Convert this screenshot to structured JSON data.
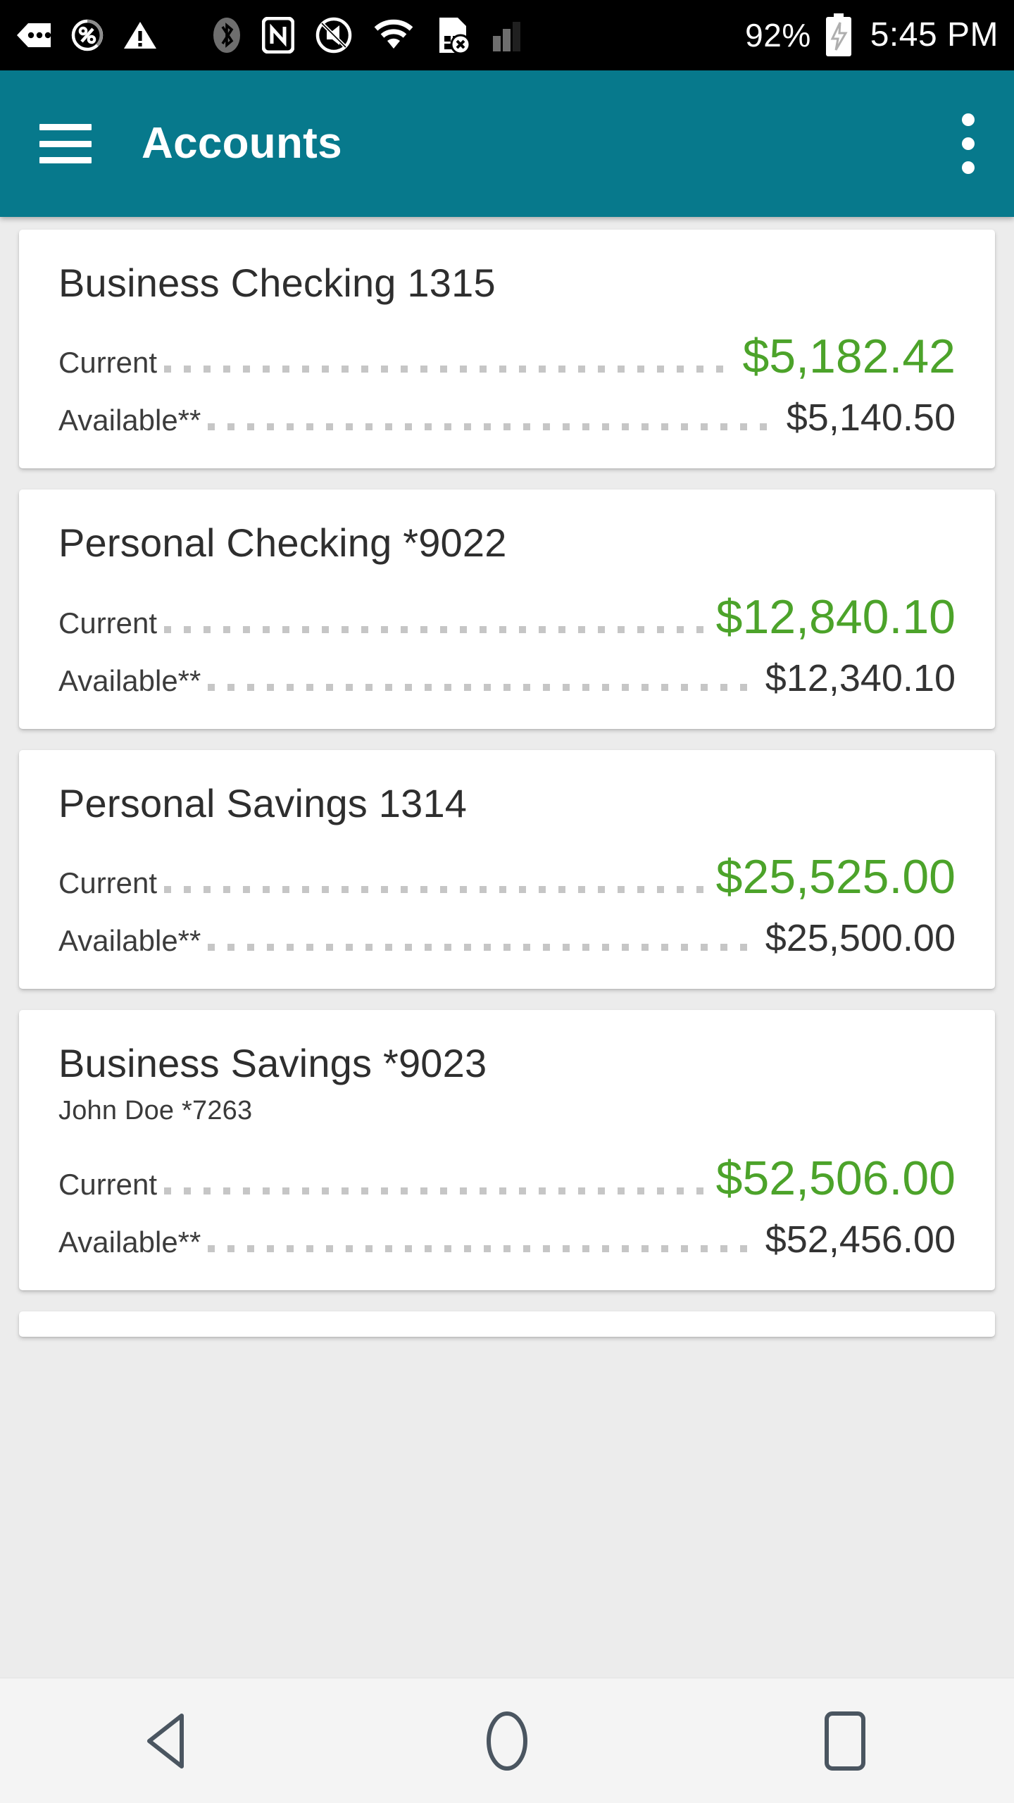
{
  "status_bar": {
    "battery_percent": "92%",
    "clock": "5:45 PM",
    "icons_left": [
      "more-notifications-icon",
      "data-saver-percent-icon",
      "warning-triangle-icon"
    ],
    "icons_mid": [
      "bluetooth-icon",
      "nfc-icon",
      "mute-vibrate-off-icon",
      "wifi-icon",
      "sim-card-error-icon",
      "signal-bars-icon"
    ],
    "icons_right": [
      "battery-charging-icon"
    ],
    "background_color": "#000000",
    "foreground_color": "#FFFFFF"
  },
  "app_bar": {
    "title": "Accounts",
    "menu_icon": "hamburger-menu-icon",
    "overflow_icon": "overflow-menu-icon",
    "background_color": "#07798C",
    "text_color": "#FFFFFF"
  },
  "labels": {
    "current": "Current",
    "available": "Available**"
  },
  "colors": {
    "accent_teal": "#07798C",
    "current_green": "#4CA32A",
    "available_dark": "#333333",
    "page_background": "#ECECEC",
    "card_background": "#FFFFFF"
  },
  "accounts": [
    {
      "name": "Business Checking 1315",
      "subtitle": "",
      "current_label": "Current",
      "current_value": "$5,182.42",
      "available_label": "Available**",
      "available_value": "$5,140.50"
    },
    {
      "name": "Personal Checking *9022",
      "subtitle": "",
      "current_label": "Current",
      "current_value": "$12,840.10",
      "available_label": "Available**",
      "available_value": "$12,340.10"
    },
    {
      "name": "Personal Savings 1314",
      "subtitle": "",
      "current_label": "Current",
      "current_value": "$25,525.00",
      "available_label": "Available**",
      "available_value": "$25,500.00"
    },
    {
      "name": "Business Savings *9023",
      "subtitle": "John Doe *7263",
      "current_label": "Current",
      "current_value": "$52,506.00",
      "available_label": "Available**",
      "available_value": "$52,456.00"
    }
  ],
  "nav_bar": {
    "back_icon": "back-triangle-icon",
    "home_icon": "home-circle-icon",
    "recents_icon": "recents-square-icon",
    "icon_color": "#4A5560",
    "background_color": "#F4F4F4"
  }
}
